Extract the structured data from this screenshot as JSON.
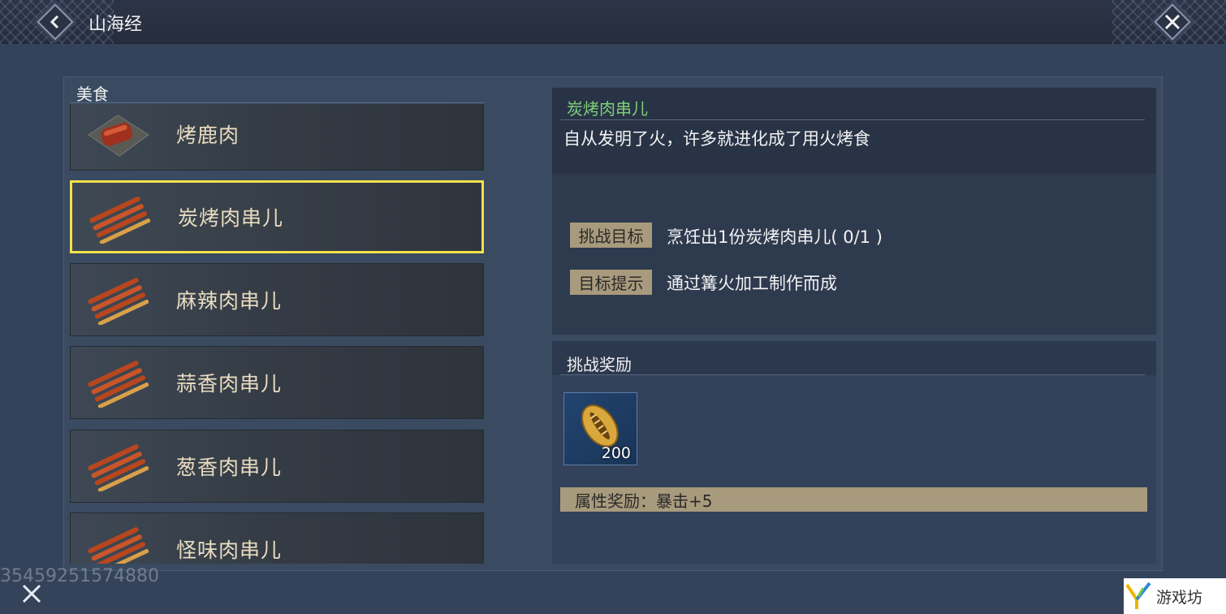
{
  "header": {
    "title": "山海经",
    "back_icon": "back-chevron-icon",
    "close_icon": "close-x-icon"
  },
  "sidebar": {
    "category": "美食",
    "items": [
      {
        "label": "烤鹿肉",
        "icon": "roast-venison-icon",
        "selected": false
      },
      {
        "label": "炭烤肉串儿",
        "icon": "meat-skewers-icon",
        "selected": true
      },
      {
        "label": "麻辣肉串儿",
        "icon": "meat-skewers-icon",
        "selected": false
      },
      {
        "label": "蒜香肉串儿",
        "icon": "meat-skewers-icon",
        "selected": false
      },
      {
        "label": "葱香肉串儿",
        "icon": "meat-skewers-icon",
        "selected": false
      },
      {
        "label": "怪味肉串儿",
        "icon": "meat-skewers-icon",
        "selected": false
      }
    ]
  },
  "detail": {
    "title": "炭烤肉串儿",
    "description": "自从发明了火，许多就进化成了用火烤食",
    "goal_label": "挑战目标",
    "goal_text": "烹饪出1份炭烤肉串儿( 0/1 )",
    "hint_label": "目标提示",
    "hint_text": "通过篝火加工制作而成"
  },
  "reward": {
    "title": "挑战奖励",
    "item_icon": "gold-shell-coin-icon",
    "item_count": "200",
    "attribute": "属性奖励：暴击+5"
  },
  "footer": {
    "uid": "35459251574880",
    "watermark": "游戏坊"
  },
  "colors": {
    "selected_border": "#f2e14c",
    "detail_title": "#7fd07a",
    "tag_bg": "#a89a7c"
  }
}
